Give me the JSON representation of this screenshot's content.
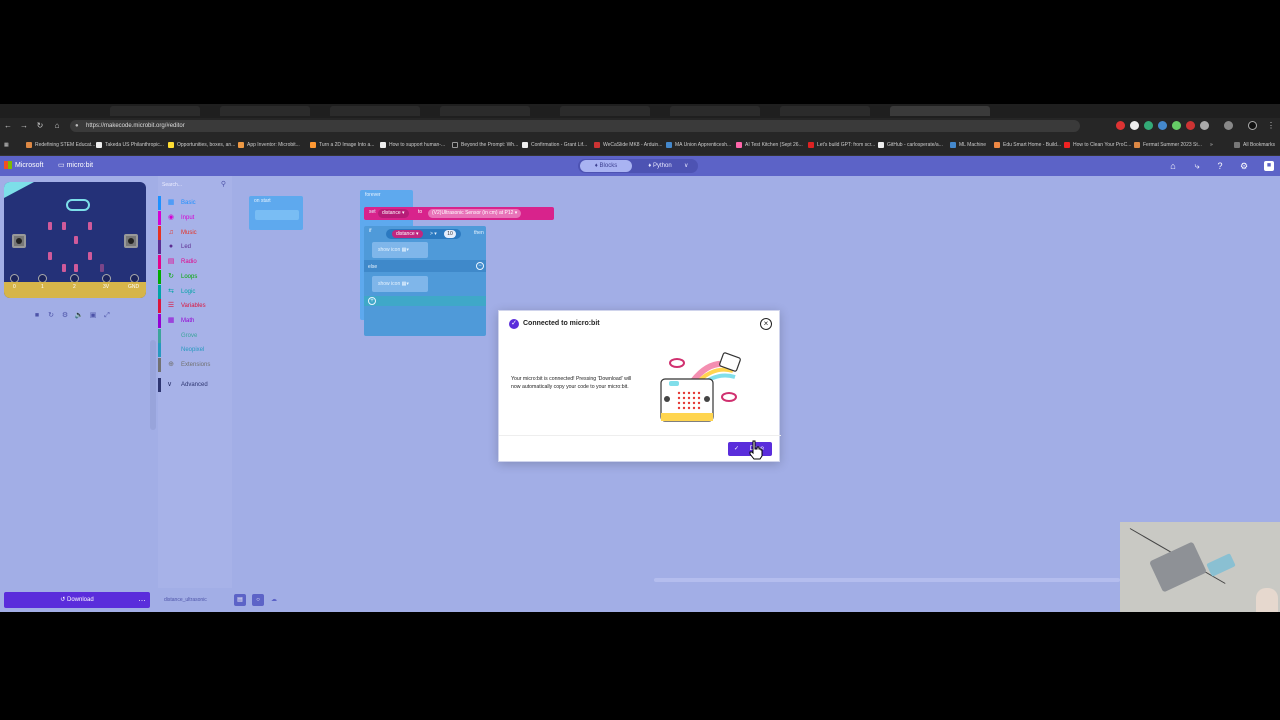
{
  "browser": {
    "tabs": [
      "",
      "",
      "",
      "",
      "",
      "",
      "",
      "",
      "",
      "",
      ""
    ],
    "url": "https://makecode.microbit.org/#editor",
    "bookmarks": [
      "Redefining STEM Educat...",
      "Takeda US Philanthropic...",
      "Opportunities, boxes, an...",
      "App Inventor: Microbit...",
      "Turn a 2D Image Into a...",
      "How to support human-...",
      "Beyond the Prompt: Wh...",
      "Confirmation - Grant Lif...",
      "WeCaSlide MK8 - Arduin...",
      "MA Union Apprenticesh...",
      "AI Test Kitchen (Sept 26...",
      "Let's build GPT: from scr...",
      "GitHub - carlosperate/a...",
      "ML Machine",
      "Edu Smart Home - Build...",
      "How to Clean Your ProC...",
      "Fermat Summer 2023 St...",
      "All Bookmarks"
    ]
  },
  "header": {
    "brand": "Microsoft",
    "product": "micro:bit",
    "toggle_blocks": "Blocks",
    "toggle_python": "Python"
  },
  "toolbox": {
    "search_placeholder": "Search...",
    "categories": [
      {
        "label": "Basic",
        "color": "#1e90ff"
      },
      {
        "label": "Input",
        "color": "#d400d4"
      },
      {
        "label": "Music",
        "color": "#e63022"
      },
      {
        "label": "Led",
        "color": "#5c2d91"
      },
      {
        "label": "Radio",
        "color": "#e3008c"
      },
      {
        "label": "Loops",
        "color": "#00aa00"
      },
      {
        "label": "Logic",
        "color": "#00a4a6"
      },
      {
        "label": "Variables",
        "color": "#dc143c"
      },
      {
        "label": "Math",
        "color": "#9400d3"
      },
      {
        "label": "Grove",
        "color": "#3ca59b"
      },
      {
        "label": "Neopixel",
        "color": "#2699bf"
      },
      {
        "label": "Extensions",
        "color": "#717171"
      }
    ],
    "advanced": "Advanced"
  },
  "workspace": {
    "on_start": "on start",
    "forever": "forever",
    "set_label": "set",
    "set_var": "distance",
    "set_to": "to",
    "set_value": "(V2)Ultrasonic Sensor (in cm) at P12",
    "if_label": "if",
    "if_var": "distance",
    "if_op": ">",
    "if_num": "10",
    "if_then": "then",
    "show_icon_1": "show icon",
    "else_label": "else",
    "show_icon_2": "show icon"
  },
  "bottom": {
    "download": "Download",
    "project_name": "distance_ultrasonic"
  },
  "modal": {
    "title": "Connected to micro:bit",
    "body": "Your micro:bit is connected! Pressing 'Download' will now automatically copy your code to your micro:bit.",
    "done": "Done"
  },
  "colors": {
    "workspace_bg": "#a2aee6",
    "header_bg": "#5c63c7",
    "accent_purple": "#5a2ddb"
  }
}
